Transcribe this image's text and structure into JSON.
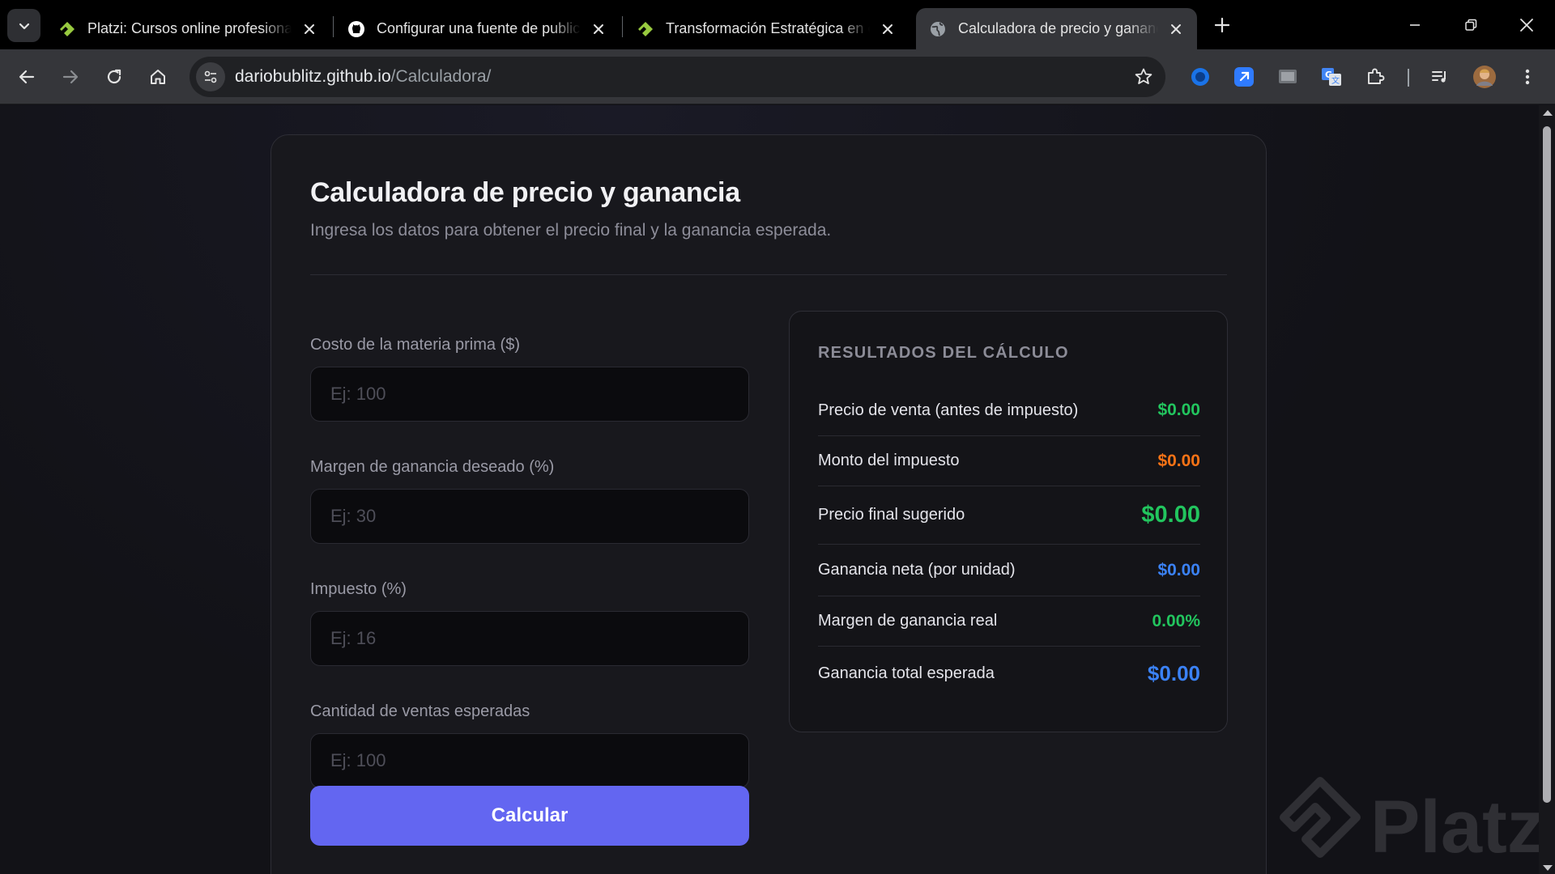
{
  "browser": {
    "tabs": [
      {
        "title": "Platzi: Cursos online profesionales de tecnología",
        "favicon": "platzi-logo-icon",
        "active": false
      },
      {
        "title": "Configurar una fuente de publicación para tu sitio de GitHub Pages",
        "favicon": "github-logo-icon",
        "active": false
      },
      {
        "title": "Transformación Estratégica en el Negocio",
        "favicon": "platzi-logo-icon",
        "active": false
      },
      {
        "title": "Calculadora de precio y ganancia",
        "favicon": "globe-icon",
        "active": true
      }
    ],
    "url_host": "dariobublitz.github.io",
    "url_path": "/Calculadora/",
    "accent": "#35363a"
  },
  "page": {
    "title": "Calculadora de precio y ganancia",
    "subtitle": "Ingresa los datos para obtener el precio final y la ganancia esperada.",
    "fields": [
      {
        "label": "Costo de la materia prima ($)",
        "placeholder": "Ej: 100",
        "value": ""
      },
      {
        "label": "Margen de ganancia deseado (%)",
        "placeholder": "Ej: 30",
        "value": ""
      },
      {
        "label": "Impuesto (%)",
        "placeholder": "Ej: 16",
        "value": ""
      },
      {
        "label": "Cantidad de ventas esperadas",
        "placeholder": "Ej: 100",
        "value": ""
      }
    ],
    "button_label": "Calcular",
    "button_color": "#6366f1",
    "results": {
      "title": "RESULTADOS DEL CÁLCULO",
      "rows": [
        {
          "label": "Precio de venta (antes de impuesto)",
          "value": "$0.00",
          "color": "#22c55e"
        },
        {
          "label": "Monto del impuesto",
          "value": "$0.00",
          "color": "#f97316"
        },
        {
          "label": "Precio final sugerido",
          "value": "$0.00",
          "color": "#22c55e"
        },
        {
          "label": "Ganancia neta (por unidad)",
          "value": "$0.00",
          "color": "#3b82f6"
        },
        {
          "label": "Margen de ganancia real",
          "value": "0.00%",
          "color": "#22c55e"
        },
        {
          "label": "Ganancia total esperada",
          "value": "$0.00",
          "color": "#3b82f6"
        }
      ]
    },
    "watermark": "Platzi"
  }
}
